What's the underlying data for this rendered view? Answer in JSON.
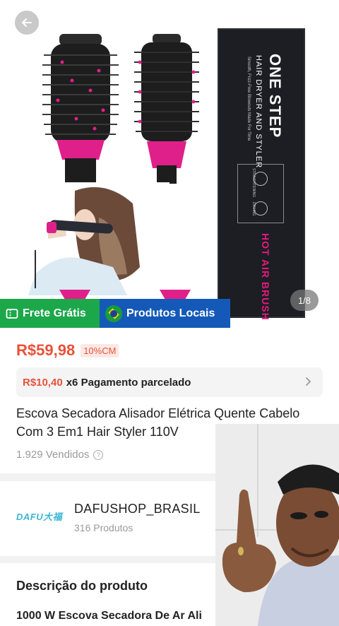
{
  "gallery": {
    "page_indicator": "1/8",
    "box": {
      "title": "ONE STEP",
      "subtitle": "HAIR DRYER AND STYLER",
      "tagline": "Smooth, Frizz-Free Blowouts Made For Time",
      "product": "HOT AIR BRUSH",
      "feature_1": "STRAIGHTENING",
      "feature_2": "DRYING"
    }
  },
  "badges": {
    "frete": "Frete Grátis",
    "locais": "Produtos Locais"
  },
  "product": {
    "price": "R$59,98",
    "discount": "10%CM",
    "installment_price": "R$10,40",
    "installment_label": "x6 Pagamento parcelado",
    "title": "Escova Secadora Alisador Elétrica Quente Cabelo Com 3 Em1 Hair Styler 110V",
    "sold": "1.929 Vendidos"
  },
  "shop": {
    "logo_text": "DAFU大福",
    "name": "DAFUSHOP_BRASIL",
    "product_count": "316 Produtos"
  },
  "description": {
    "heading": "Descrição do produto",
    "first_line": "1000 W Escova Secadora De Ar Ali"
  },
  "colors": {
    "price": "#e8523a",
    "frete_bg": "#1ca84a",
    "locais_bg": "#1459b8",
    "brush_accent": "#e0208a"
  }
}
